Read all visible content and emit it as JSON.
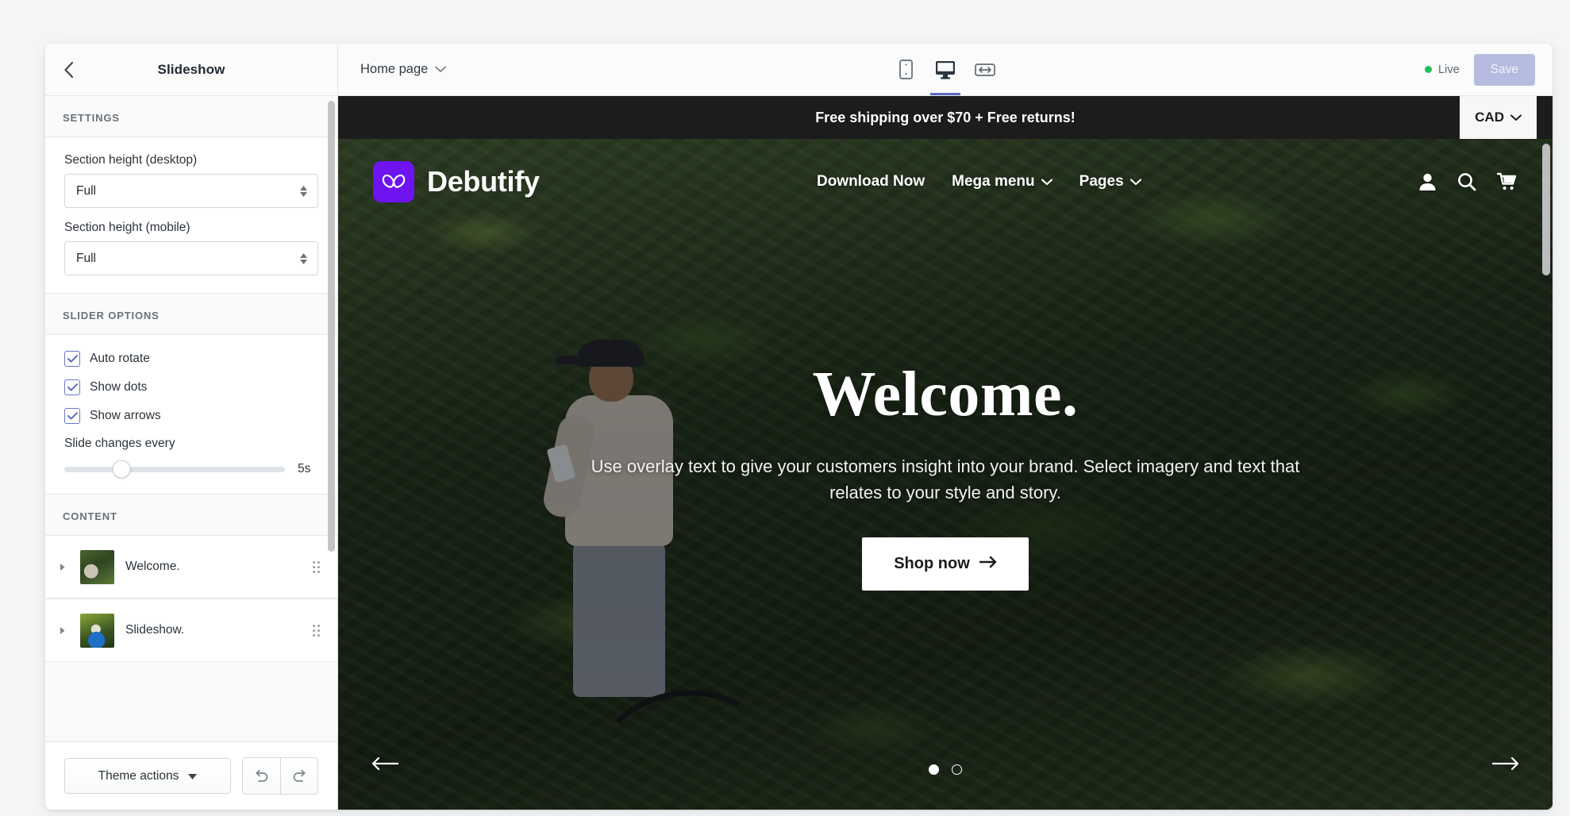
{
  "sidebar": {
    "back_icon": "chevron-left-icon",
    "title": "Slideshow",
    "settings_heading": "SETTINGS",
    "fields": [
      {
        "label": "Section height (desktop)",
        "value": "Full"
      },
      {
        "label": "Section height (mobile)",
        "value": "Full"
      }
    ],
    "slider_options_heading": "SLIDER OPTIONS",
    "checkboxes": [
      {
        "label": "Auto rotate",
        "checked": true
      },
      {
        "label": "Show dots",
        "checked": true
      },
      {
        "label": "Show arrows",
        "checked": true
      }
    ],
    "slide_interval": {
      "label": "Slide changes every",
      "value": "5s",
      "percent": 26
    },
    "content_heading": "CONTENT",
    "content_rows": [
      {
        "title": "Welcome."
      },
      {
        "title": "Slideshow."
      }
    ],
    "footer": {
      "theme_actions": "Theme actions",
      "undo_icon": "undo-icon",
      "redo_icon": "redo-icon"
    }
  },
  "topbar": {
    "page_selector": "Home page",
    "devices": [
      {
        "name": "mobile-view",
        "active": false
      },
      {
        "name": "desktop-view",
        "active": true
      },
      {
        "name": "fullwidth-view",
        "active": false
      }
    ],
    "live_label": "Live",
    "live_color": "#1ebf57",
    "save_label": "Save"
  },
  "preview": {
    "announcement": "Free shipping over $70 + Free returns!",
    "currency": "CAD",
    "brand_name": "Debutify",
    "brand_color": "#6d14f0",
    "nav": [
      {
        "label": "Download Now",
        "caret": false
      },
      {
        "label": "Mega menu",
        "caret": true
      },
      {
        "label": "Pages",
        "caret": true
      }
    ],
    "header_icons": [
      "account-icon",
      "search-icon",
      "cart-icon"
    ],
    "hero": {
      "title": "Welcome.",
      "text": "Use overlay text to give your customers insight into your brand. Select imagery and text that relates to your style and story.",
      "cta": "Shop now"
    },
    "slider": {
      "prev_icon": "arrow-left-icon",
      "next_icon": "arrow-right-icon",
      "dots": [
        true,
        false
      ]
    }
  }
}
